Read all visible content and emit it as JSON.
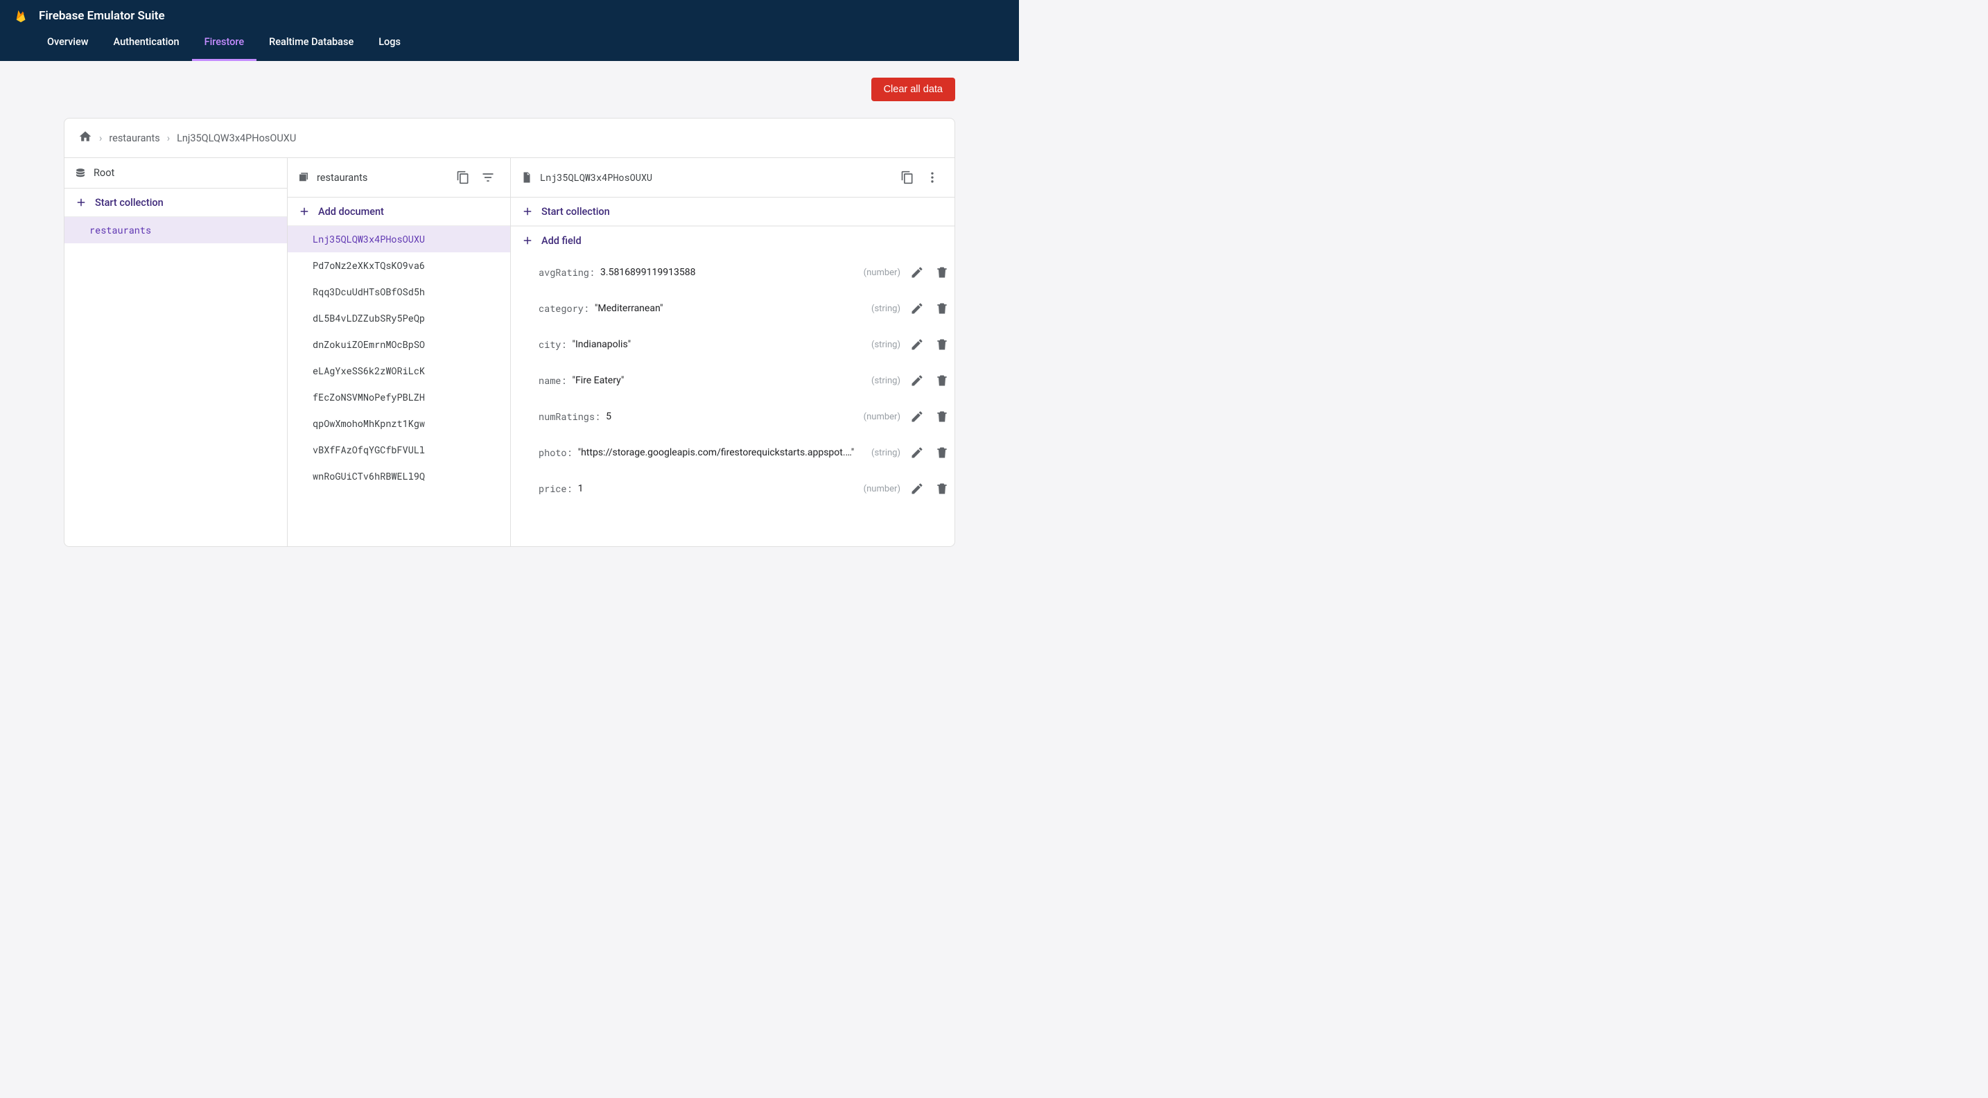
{
  "header": {
    "title": "Firebase Emulator Suite",
    "tabs": [
      {
        "label": "Overview",
        "active": false
      },
      {
        "label": "Authentication",
        "active": false
      },
      {
        "label": "Firestore",
        "active": true
      },
      {
        "label": "Realtime Database",
        "active": false
      },
      {
        "label": "Logs",
        "active": false
      }
    ]
  },
  "actions": {
    "clear_all": "Clear all data"
  },
  "breadcrumb": {
    "items": [
      "restaurants",
      "Lnj35QLQW3x4PHosOUXU"
    ]
  },
  "col_root": {
    "title": "Root",
    "start_collection": "Start collection",
    "items": [
      {
        "id": "restaurants",
        "selected": true
      }
    ]
  },
  "col_docs": {
    "title": "restaurants",
    "add_document": "Add document",
    "items": [
      {
        "id": "Lnj35QLQW3x4PHosOUXU",
        "selected": true
      },
      {
        "id": "Pd7oNz2eXKxTQsKO9va6"
      },
      {
        "id": "Rqq3DcuUdHTsOBfOSd5h"
      },
      {
        "id": "dL5B4vLDZZubSRy5PeQp"
      },
      {
        "id": "dnZokuiZOEmrnMOcBpSO"
      },
      {
        "id": "eLAgYxeSS6k2zWORiLcK"
      },
      {
        "id": "fEcZoNSVMNoPefyPBLZH"
      },
      {
        "id": "qpOwXmohoMhKpnzt1Kgw"
      },
      {
        "id": "vBXfFAzOfqYGCfbFVULl"
      },
      {
        "id": "wnRoGUiCTv6hRBWELl9Q"
      }
    ]
  },
  "col_fields": {
    "doc_id": "Lnj35QLQW3x4PHosOUXU",
    "start_collection": "Start collection",
    "add_field": "Add field",
    "fields": [
      {
        "key": "avgRating",
        "value": "3.5816899119913588",
        "type": "number",
        "quoted": false
      },
      {
        "key": "category",
        "value": "Mediterranean",
        "type": "string",
        "quoted": true
      },
      {
        "key": "city",
        "value": "Indianapolis",
        "type": "string",
        "quoted": true
      },
      {
        "key": "name",
        "value": "Fire Eatery",
        "type": "string",
        "quoted": true
      },
      {
        "key": "numRatings",
        "value": "5",
        "type": "number",
        "quoted": false
      },
      {
        "key": "photo",
        "value": "https://storage.googleapis.com/firestorequickstarts.appspot.…",
        "type": "string",
        "quoted": true
      },
      {
        "key": "price",
        "value": "1",
        "type": "number",
        "quoted": false
      }
    ]
  }
}
